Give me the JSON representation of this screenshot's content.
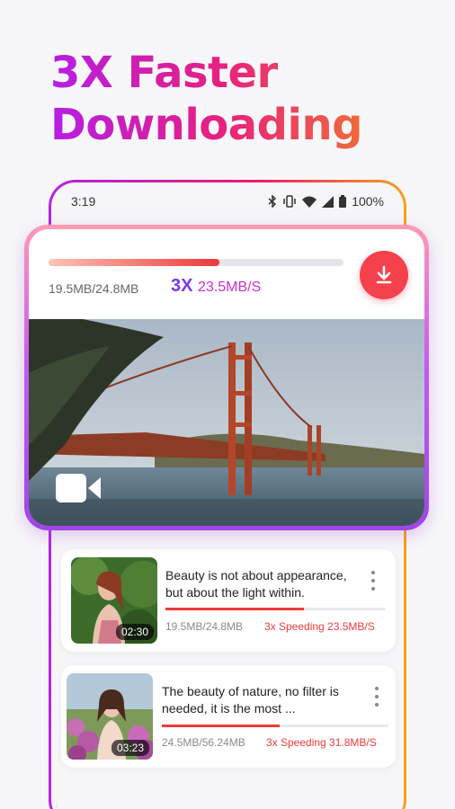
{
  "headline": {
    "line1": "3X Faster",
    "line2": "Downloading"
  },
  "status_bar": {
    "time": "3:19",
    "battery": "100%"
  },
  "download_card": {
    "size_text": "19.5MB/24.8MB",
    "speed_multiplier": "3X",
    "speed_value": "23.5MB/S",
    "progress": 0.58,
    "icons": [
      "download-icon",
      "video-camera-icon"
    ]
  },
  "downloads": [
    {
      "title": "Beauty is not about appearance, but about the light within.",
      "duration": "02:30",
      "size": "19.5MB/24.8MB",
      "speed": "3x Speeding 23.5MB/S",
      "progress": 0.63
    },
    {
      "title": "The beauty of nature, no filter is needed, it is the most ...",
      "duration": "03:23",
      "size": "24.5MB/56.24MB",
      "speed": "3x Speeding 31.8MB/S",
      "progress": 0.52
    }
  ],
  "colors": {
    "accent_red": "#ef3b3b",
    "accent_purple": "#7a38e8",
    "gradient_start": "#b61ee6",
    "gradient_end": "#f06a3a"
  }
}
